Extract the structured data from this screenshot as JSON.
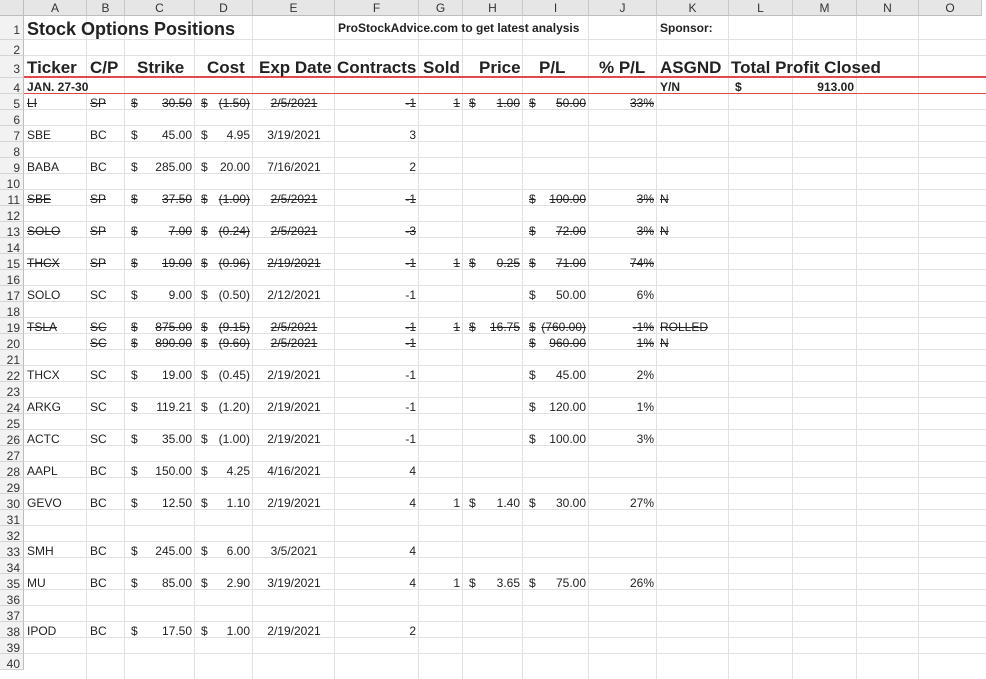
{
  "columns": [
    "A",
    "B",
    "C",
    "D",
    "E",
    "F",
    "G",
    "H",
    "I",
    "J",
    "K",
    "L",
    "M",
    "N",
    "O"
  ],
  "rows": [
    "1",
    "2",
    "3",
    "4",
    "5",
    "6",
    "7",
    "8",
    "9",
    "10",
    "11",
    "12",
    "13",
    "14",
    "15",
    "16",
    "17",
    "18",
    "19",
    "20",
    "21",
    "22",
    "23",
    "24",
    "25",
    "26",
    "27",
    "28",
    "29",
    "30",
    "31",
    "32",
    "33",
    "34",
    "35",
    "36",
    "37",
    "38",
    "39",
    "40"
  ],
  "header": {
    "title": "Stock Options Positions",
    "link": "ProStockAdvice.com to get latest analysis",
    "sponsor": "Sponsor:",
    "ticker": "Ticker",
    "cp": "C/P",
    "strike": "Strike",
    "cost": "Cost",
    "exp": "Exp Date",
    "contracts": "Contracts",
    "sold": "Sold",
    "price": "Price",
    "pl": "P/L",
    "pct": "% P/L",
    "asgnd": "ASGND",
    "total": "Total Profit Closed",
    "week": "JAN. 27-30",
    "yn": "Y/N",
    "total_sym": "$",
    "total_val": "913.00"
  },
  "positions": [
    {
      "row": 5,
      "ticker": "LI",
      "cp": "SP",
      "strike": "30.50",
      "cost": "(1.50)",
      "exp": "2/5/2021",
      "contracts": "-1",
      "sold": "1",
      "price": "1.00",
      "pl": "50.00",
      "pct": "33%",
      "asgnd": "",
      "strike_out": true
    },
    {
      "row": 7,
      "ticker": "SBE",
      "cp": "BC",
      "strike": "45.00",
      "cost": "4.95",
      "exp": "3/19/2021",
      "contracts": "3",
      "sold": "",
      "price": "",
      "pl": "",
      "pct": "",
      "asgnd": "",
      "strike_out": false
    },
    {
      "row": 9,
      "ticker": "BABA",
      "cp": "BC",
      "strike": "285.00",
      "cost": "20.00",
      "exp": "7/16/2021",
      "contracts": "2",
      "sold": "",
      "price": "",
      "pl": "",
      "pct": "",
      "asgnd": "",
      "strike_out": false
    },
    {
      "row": 11,
      "ticker": "SBE",
      "cp": "SP",
      "strike": "37.50",
      "cost": "(1.00)",
      "exp": "2/5/2021",
      "contracts": "-1",
      "sold": "",
      "price": "",
      "pl": "100.00",
      "pct": "3%",
      "asgnd": "N",
      "strike_out": true
    },
    {
      "row": 13,
      "ticker": "SOLO",
      "cp": "SP",
      "strike": "7.00",
      "cost": "(0.24)",
      "exp": "2/5/2021",
      "contracts": "-3",
      "sold": "",
      "price": "",
      "pl": "72.00",
      "pct": "3%",
      "asgnd": "N",
      "strike_out": true
    },
    {
      "row": 15,
      "ticker": "THCX",
      "cp": "SP",
      "strike": "19.00",
      "cost": "(0.96)",
      "exp": "2/19/2021",
      "contracts": "-1",
      "sold": "1",
      "price": "0.25",
      "pl": "71.00",
      "pct": "74%",
      "asgnd": "",
      "strike_out": true
    },
    {
      "row": 17,
      "ticker": "SOLO",
      "cp": "SC",
      "strike": "9.00",
      "cost": "(0.50)",
      "exp": "2/12/2021",
      "contracts": "-1",
      "sold": "",
      "price": "",
      "pl": "50.00",
      "pct": "6%",
      "asgnd": "",
      "strike_out": false
    },
    {
      "row": 19,
      "ticker": "TSLA",
      "cp": "SC",
      "strike": "875.00",
      "cost": "(9.15)",
      "exp": "2/5/2021",
      "contracts": "-1",
      "sold": "1",
      "price": "16.75",
      "pl": "(760.00)",
      "pct": "-1%",
      "asgnd": "ROLLED",
      "strike_out": true
    },
    {
      "row": 20,
      "ticker": "",
      "cp": "SC",
      "strike": "890.00",
      "cost": "(9.60)",
      "exp": "2/5/2021",
      "contracts": "-1",
      "sold": "",
      "price": "",
      "pl": "960.00",
      "pct": "1%",
      "asgnd": "N",
      "strike_out": true
    },
    {
      "row": 22,
      "ticker": "THCX",
      "cp": "SC",
      "strike": "19.00",
      "cost": "(0.45)",
      "exp": "2/19/2021",
      "contracts": "-1",
      "sold": "",
      "price": "",
      "pl": "45.00",
      "pct": "2%",
      "asgnd": "",
      "strike_out": false
    },
    {
      "row": 24,
      "ticker": "ARKG",
      "cp": "SC",
      "strike": "119.21",
      "cost": "(1.20)",
      "exp": "2/19/2021",
      "contracts": "-1",
      "sold": "",
      "price": "",
      "pl": "120.00",
      "pct": "1%",
      "asgnd": "",
      "strike_out": false
    },
    {
      "row": 26,
      "ticker": "ACTC",
      "cp": "SC",
      "strike": "35.00",
      "cost": "(1.00)",
      "exp": "2/19/2021",
      "contracts": "-1",
      "sold": "",
      "price": "",
      "pl": "100.00",
      "pct": "3%",
      "asgnd": "",
      "strike_out": false
    },
    {
      "row": 28,
      "ticker": "AAPL",
      "cp": "BC",
      "strike": "150.00",
      "cost": "4.25",
      "exp": "4/16/2021",
      "contracts": "4",
      "sold": "",
      "price": "",
      "pl": "",
      "pct": "",
      "asgnd": "",
      "strike_out": false
    },
    {
      "row": 30,
      "ticker": "GEVO",
      "cp": "BC",
      "strike": "12.50",
      "cost": "1.10",
      "exp": "2/19/2021",
      "contracts": "4",
      "sold": "1",
      "price": "1.40",
      "pl": "30.00",
      "pct": "27%",
      "asgnd": "",
      "strike_out": false
    },
    {
      "row": 33,
      "ticker": "SMH",
      "cp": "BC",
      "strike": "245.00",
      "cost": "6.00",
      "exp": "3/5/2021",
      "contracts": "4",
      "sold": "",
      "price": "",
      "pl": "",
      "pct": "",
      "asgnd": "",
      "strike_out": false
    },
    {
      "row": 35,
      "ticker": "MU",
      "cp": "BC",
      "strike": "85.00",
      "cost": "2.90",
      "exp": "3/19/2021",
      "contracts": "4",
      "sold": "1",
      "price": "3.65",
      "pl": "75.00",
      "pct": "26%",
      "asgnd": "",
      "strike_out": false
    },
    {
      "row": 38,
      "ticker": "IPOD",
      "cp": "BC",
      "strike": "17.50",
      "cost": "1.00",
      "exp": "2/19/2021",
      "contracts": "2",
      "sold": "",
      "price": "",
      "pl": "",
      "pct": "",
      "asgnd": "",
      "strike_out": false
    }
  ],
  "currency_symbol": "$",
  "colors": {
    "header_rule": "#e04a4a",
    "grid": "#e1e1e1"
  }
}
